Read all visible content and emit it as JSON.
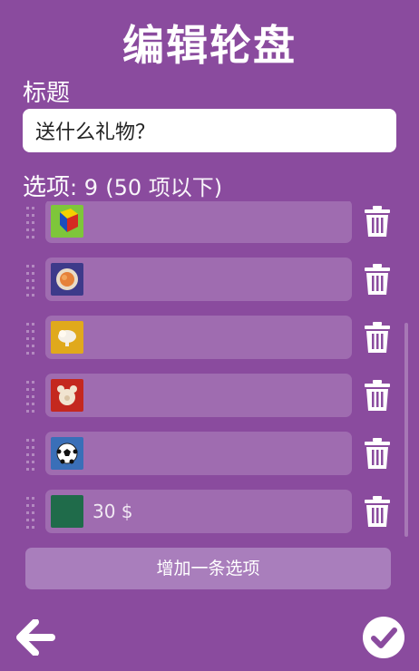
{
  "header": {
    "title": "编辑轮盘"
  },
  "title_field": {
    "label": "标题",
    "value": "送什么礼物？"
  },
  "options_header": {
    "label": "选项",
    "count_text": ": 9",
    "limit_text": "(50 项以下)"
  },
  "options": [
    {
      "icon": "rubiks-cube-icon",
      "text": ""
    },
    {
      "icon": "food-bowl-icon",
      "text": ""
    },
    {
      "icon": "cake-icon",
      "text": ""
    },
    {
      "icon": "teddy-bear-icon",
      "text": ""
    },
    {
      "icon": "soccer-ball-icon",
      "text": ""
    },
    {
      "icon": "green-swatch-icon",
      "text": "30 $"
    }
  ],
  "add_button": {
    "label": "增加一条选项"
  },
  "colors": {
    "background": "#8a4b9e",
    "field": "#9f6cb0",
    "button": "#a97ebc"
  }
}
